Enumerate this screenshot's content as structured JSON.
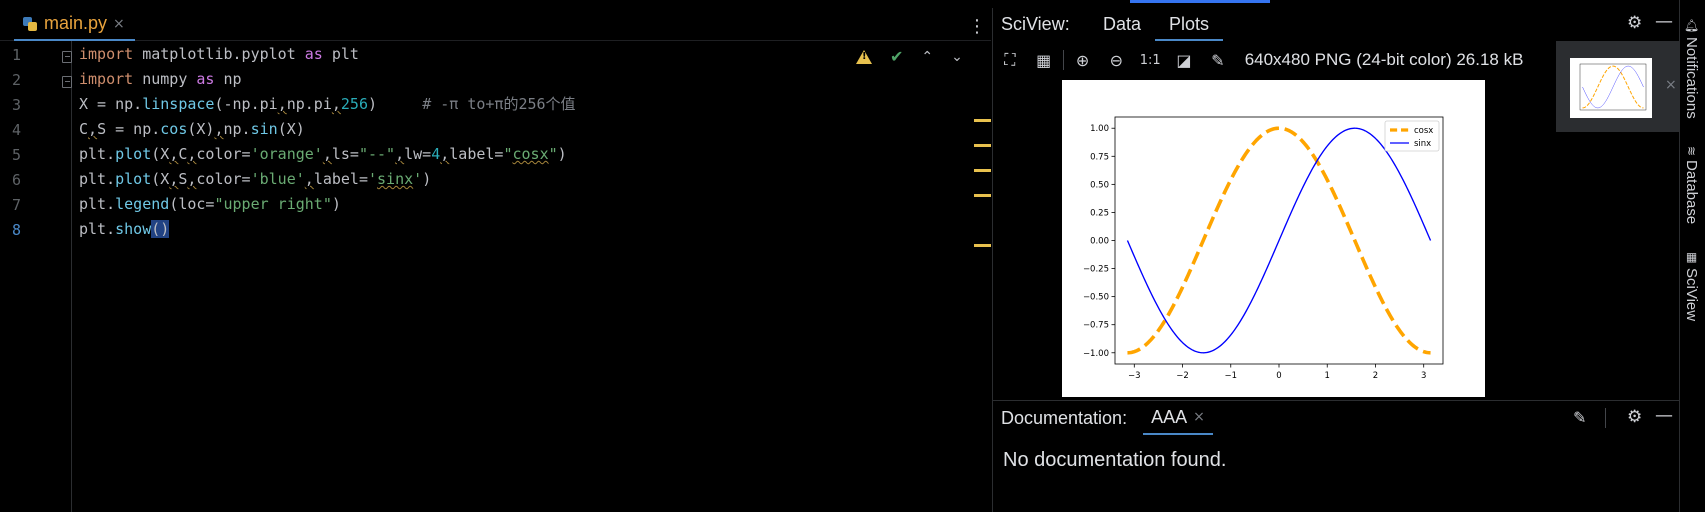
{
  "editor": {
    "tab_label": "main.py",
    "tab_close": "×",
    "menu": "⋮",
    "line_numbers": [
      "1",
      "2",
      "3",
      "4",
      "5",
      "6",
      "7",
      "8"
    ],
    "lines": [
      [
        {
          "t": "import",
          "c": "kw"
        },
        {
          "t": " matplotlib.pyplot ",
          "c": "plain"
        },
        {
          "t": "as",
          "c": "kw2"
        },
        {
          "t": " plt",
          "c": "plain"
        }
      ],
      [
        {
          "t": "import",
          "c": "kw"
        },
        {
          "t": " numpy ",
          "c": "plain"
        },
        {
          "t": "as",
          "c": "kw2"
        },
        {
          "t": " np",
          "c": "plain"
        }
      ],
      [
        {
          "t": "X = np.",
          "c": "plain"
        },
        {
          "t": "linspace",
          "c": "fn2"
        },
        {
          "t": "(-np.pi",
          "c": "plain"
        },
        {
          "t": ",",
          "c": "plain sq"
        },
        {
          "t": "np.pi",
          "c": "plain"
        },
        {
          "t": ",",
          "c": "plain sq"
        },
        {
          "t": "256",
          "c": "num"
        },
        {
          "t": ")     ",
          "c": "plain"
        },
        {
          "t": "# -π to+π的256个值",
          "c": "cm"
        }
      ],
      [
        {
          "t": "C",
          "c": "plain"
        },
        {
          "t": ",",
          "c": "plain sq"
        },
        {
          "t": "S = np.",
          "c": "plain"
        },
        {
          "t": "cos",
          "c": "fn2"
        },
        {
          "t": "(X)",
          "c": "plain"
        },
        {
          "t": ",",
          "c": "plain sq"
        },
        {
          "t": "np.",
          "c": "plain"
        },
        {
          "t": "sin",
          "c": "fn2"
        },
        {
          "t": "(X)",
          "c": "plain"
        }
      ],
      [
        {
          "t": "plt.",
          "c": "plain"
        },
        {
          "t": "plot",
          "c": "fn2"
        },
        {
          "t": "(X",
          "c": "plain"
        },
        {
          "t": ",",
          "c": "plain sq"
        },
        {
          "t": "C",
          "c": "plain"
        },
        {
          "t": ",",
          "c": "plain sq"
        },
        {
          "t": "color=",
          "c": "plain"
        },
        {
          "t": "'orange'",
          "c": "str"
        },
        {
          "t": ",",
          "c": "plain sq"
        },
        {
          "t": "ls=",
          "c": "plain"
        },
        {
          "t": "\"--\"",
          "c": "str"
        },
        {
          "t": ",",
          "c": "plain sq"
        },
        {
          "t": "lw=",
          "c": "plain"
        },
        {
          "t": "4",
          "c": "num"
        },
        {
          "t": ",",
          "c": "plain sq"
        },
        {
          "t": "label=",
          "c": "plain"
        },
        {
          "t": "\"",
          "c": "str"
        },
        {
          "t": "cosx",
          "c": "str sq"
        },
        {
          "t": "\"",
          "c": "str"
        },
        {
          "t": ")",
          "c": "plain"
        }
      ],
      [
        {
          "t": "plt.",
          "c": "plain"
        },
        {
          "t": "plot",
          "c": "fn2"
        },
        {
          "t": "(X",
          "c": "plain"
        },
        {
          "t": ",",
          "c": "plain sq"
        },
        {
          "t": "S",
          "c": "plain"
        },
        {
          "t": ",",
          "c": "plain sq"
        },
        {
          "t": "color=",
          "c": "plain"
        },
        {
          "t": "'blue'",
          "c": "str"
        },
        {
          "t": ",",
          "c": "plain sq"
        },
        {
          "t": "label=",
          "c": "plain"
        },
        {
          "t": "'",
          "c": "str"
        },
        {
          "t": "sinx",
          "c": "str sq"
        },
        {
          "t": "'",
          "c": "str"
        },
        {
          "t": ")",
          "c": "plain"
        }
      ],
      [
        {
          "t": "plt.",
          "c": "plain"
        },
        {
          "t": "legend",
          "c": "fn2"
        },
        {
          "t": "(loc=",
          "c": "plain"
        },
        {
          "t": "\"upper right\"",
          "c": "str"
        },
        {
          "t": ")",
          "c": "plain"
        }
      ],
      [
        {
          "t": "plt.",
          "c": "plain"
        },
        {
          "t": "show",
          "c": "fn2"
        },
        {
          "t": "()",
          "c": "plain caret-box"
        }
      ]
    ],
    "inspection": {
      "warning_icon": "warning-icon",
      "check": "✔",
      "up": "⌃",
      "down": "⌄"
    },
    "colors": {
      "keyword": "#cf8e6d",
      "function": "#6fc8e6",
      "string": "#6aab73",
      "number": "#2aacb8",
      "comment": "#7a7e85",
      "warning": "#e8c14e"
    }
  },
  "sciview": {
    "title": "SciView:",
    "tabs": [
      {
        "label": "Data",
        "active": false
      },
      {
        "label": "Plots",
        "active": true
      }
    ],
    "gear": "⚙",
    "minimize": "—",
    "toolbar": {
      "fit": "⛶",
      "grid": "▦",
      "zoom_in": "⊕",
      "zoom_out": "⊖",
      "actual_size": "1:1",
      "background": "◪",
      "color_picker": "✎"
    },
    "image_info": "640x480 PNG (24-bit color) 26.18 kB",
    "thumb_close": "×"
  },
  "chart_data": {
    "type": "line",
    "x_range": [
      -3.14159,
      3.14159
    ],
    "xlim": [
      -3.4,
      3.4
    ],
    "ylim": [
      -1.1,
      1.1
    ],
    "xticks": [
      "−3",
      "−2",
      "−1",
      "0",
      "1",
      "2",
      "3"
    ],
    "xtick_values": [
      -3,
      -2,
      -1,
      0,
      1,
      2,
      3
    ],
    "yticks": [
      "−1.00",
      "−0.75",
      "−0.50",
      "−0.25",
      "0.00",
      "0.25",
      "0.50",
      "0.75",
      "1.00"
    ],
    "ytick_values": [
      -1.0,
      -0.75,
      -0.5,
      -0.25,
      0.0,
      0.25,
      0.5,
      0.75,
      1.0
    ],
    "grid": false,
    "legend_loc": "upper right",
    "series": [
      {
        "name": "cosx",
        "function": "cos",
        "color": "#ffa500",
        "style": "dashed",
        "linewidth": 4
      },
      {
        "name": "sinx",
        "function": "sin",
        "color": "#0000ff",
        "style": "solid",
        "linewidth": 1.5
      }
    ]
  },
  "documentation": {
    "title": "Documentation:",
    "tab_label": "AAA",
    "tab_close": "×",
    "edit": "✎",
    "gear": "⚙",
    "minimize": "—",
    "message": "No documentation found."
  },
  "right_strip": [
    {
      "label": "Notifications",
      "icon": "bell-icon"
    },
    {
      "label": "Database",
      "icon": "database-icon"
    },
    {
      "label": "SciView",
      "icon": "sciview-icon"
    }
  ]
}
